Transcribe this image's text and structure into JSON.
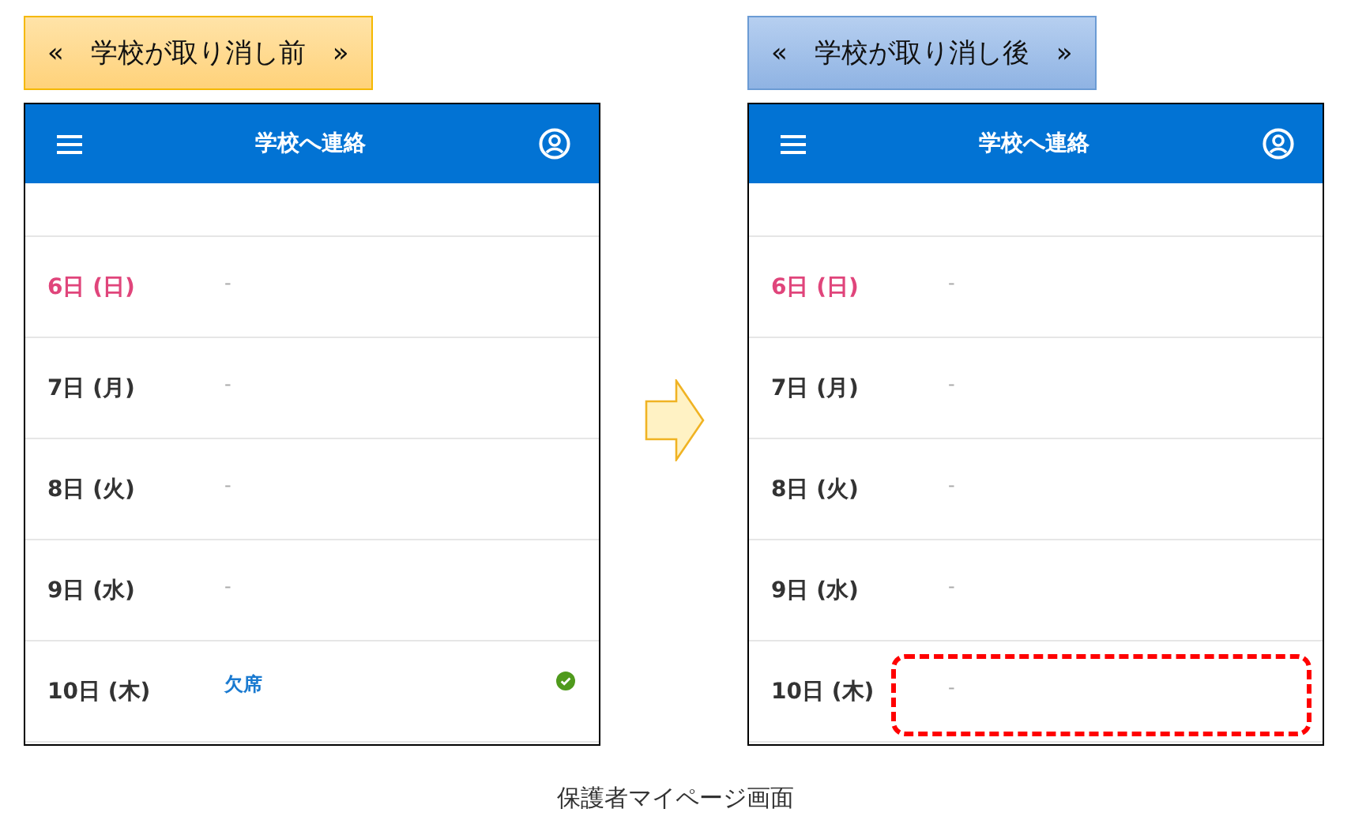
{
  "panels": [
    {
      "label": {
        "kind": "before",
        "text": "«　学校が取り消し前　»"
      },
      "app_bar": {
        "title": "学校へ連絡"
      },
      "rows": [
        {
          "date": "6日 (日)",
          "holiday": true,
          "note": "-",
          "kind": "empty",
          "confirmed": false,
          "highlighted": false
        },
        {
          "date": "7日 (月)",
          "holiday": false,
          "note": "-",
          "kind": "empty",
          "confirmed": false,
          "highlighted": false
        },
        {
          "date": "8日 (火)",
          "holiday": false,
          "note": "-",
          "kind": "empty",
          "confirmed": false,
          "highlighted": false
        },
        {
          "date": "9日 (水)",
          "holiday": false,
          "note": "-",
          "kind": "empty",
          "confirmed": false,
          "highlighted": false
        },
        {
          "date": "10日 (木)",
          "holiday": false,
          "note": "欠席",
          "kind": "absence",
          "confirmed": true,
          "highlighted": false
        }
      ]
    },
    {
      "label": {
        "kind": "after",
        "text": "«　学校が取り消し後　»"
      },
      "app_bar": {
        "title": "学校へ連絡"
      },
      "rows": [
        {
          "date": "6日 (日)",
          "holiday": true,
          "note": "-",
          "kind": "empty",
          "confirmed": false,
          "highlighted": false
        },
        {
          "date": "7日 (月)",
          "holiday": false,
          "note": "-",
          "kind": "empty",
          "confirmed": false,
          "highlighted": false
        },
        {
          "date": "8日 (火)",
          "holiday": false,
          "note": "-",
          "kind": "empty",
          "confirmed": false,
          "highlighted": false
        },
        {
          "date": "9日 (水)",
          "holiday": false,
          "note": "-",
          "kind": "empty",
          "confirmed": false,
          "highlighted": false
        },
        {
          "date": "10日 (木)",
          "holiday": false,
          "note": "-",
          "kind": "empty",
          "confirmed": false,
          "highlighted": true
        }
      ]
    }
  ],
  "caption": "保護者マイページ画面"
}
